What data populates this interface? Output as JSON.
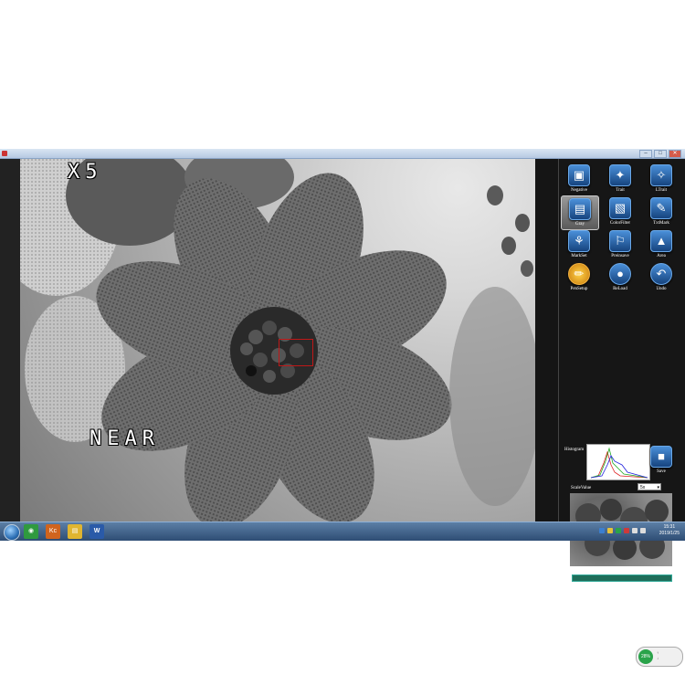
{
  "viewer": {
    "zoom_overlay": "X5",
    "focus_overlay": "NEAR"
  },
  "window": {
    "buttons": [
      "–",
      "□",
      "✕"
    ]
  },
  "toolbar": {
    "tools": [
      {
        "label": "Negative",
        "icon": "negative-icon",
        "glyph": "▣"
      },
      {
        "label": "Trait",
        "icon": "trait-icon",
        "glyph": "✦"
      },
      {
        "label": "LTrait",
        "icon": "ltrait-icon",
        "glyph": "✧"
      },
      {
        "label": "Gray",
        "icon": "gray-icon",
        "glyph": "▤"
      },
      {
        "label": "ColorFilter",
        "icon": "color-filter-icon",
        "glyph": "▧"
      },
      {
        "label": "TxtMark",
        "icon": "text-mark-icon",
        "glyph": "✎"
      },
      {
        "label": "MarkSet",
        "icon": "mark-set-icon",
        "glyph": "⚘"
      },
      {
        "label": "Preinsave",
        "icon": "preinsave-icon",
        "glyph": "⚐"
      },
      {
        "label": "Area",
        "icon": "area-icon",
        "glyph": "▲"
      },
      {
        "label": "PenSetup",
        "icon": "pen-setup-icon",
        "glyph": "✏"
      },
      {
        "label": "ReLoad",
        "icon": "reload-icon",
        "glyph": "●"
      },
      {
        "label": "Undo",
        "icon": "undo-icon",
        "glyph": "↶"
      },
      {
        "label": "Save",
        "icon": "save-icon",
        "glyph": "■"
      }
    ],
    "active_tool": "Gray"
  },
  "histogram": {
    "label": "Histogram"
  },
  "scale": {
    "label": "ScaleValue",
    "selected": "5x"
  },
  "tray_widget": {
    "percent": "28%"
  },
  "taskbar": {
    "apps": [
      {
        "name": "start-orb"
      },
      {
        "icon": "chrome-icon",
        "glyph": "◉",
        "color": "#2f9a3f"
      },
      {
        "icon": "kc-app-icon",
        "glyph": "Kc",
        "color": "#d0641e"
      },
      {
        "icon": "file-explorer-icon",
        "glyph": "▤",
        "color": "#e0b530"
      },
      {
        "icon": "word-icon",
        "glyph": "W",
        "color": "#2a5aa8"
      }
    ],
    "time": "15:31",
    "date": "2019/1/25"
  },
  "colors": {
    "accent": "#2c6fb5",
    "roi": "#c01818",
    "tray_green": "#2aa34a"
  }
}
